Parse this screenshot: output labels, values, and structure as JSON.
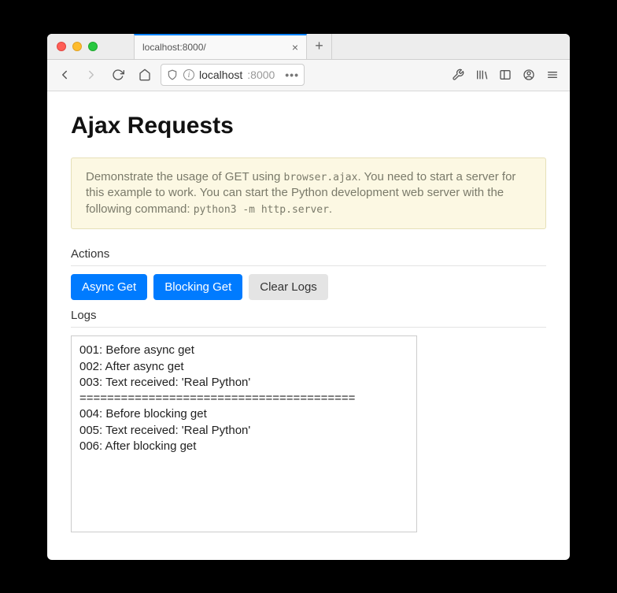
{
  "tab": {
    "title": "localhost:8000/"
  },
  "url": {
    "host": "localhost",
    "port": ":8000"
  },
  "page": {
    "title": "Ajax Requests",
    "callout_1": "Demonstrate the usage of GET using ",
    "callout_code_1": "browser.ajax",
    "callout_2": ". You need to start a server for this example to work. You can start the Python development web server with the following command: ",
    "callout_code_2": "python3 -m http.server",
    "callout_3": ".",
    "actions_label": "Actions",
    "logs_label": "Logs",
    "buttons": {
      "async": "Async Get",
      "blocking": "Blocking Get",
      "clear": "Clear Logs"
    },
    "log_lines": [
      "001: Before async get",
      "002: After async get",
      "003: Text received: 'Real Python'",
      "========================================",
      "004: Before blocking get",
      "005: Text received: 'Real Python'",
      "006: After blocking get"
    ]
  }
}
